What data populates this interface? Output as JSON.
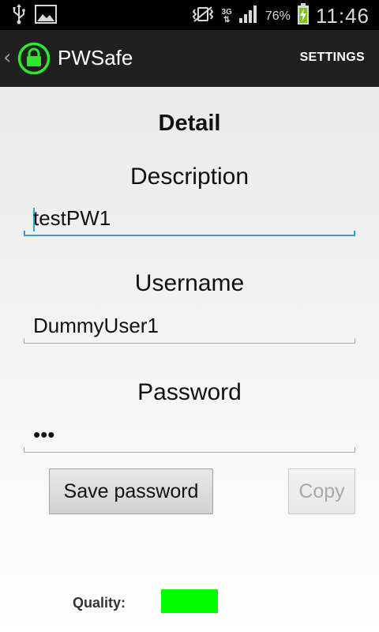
{
  "status_bar": {
    "network_type": "3G",
    "battery_percent": "76%",
    "time": "11:46",
    "icons": [
      "usb-icon",
      "gallery-icon",
      "vibrate-icon",
      "network-3g-icon",
      "signal-icon",
      "battery-charging-icon"
    ]
  },
  "action_bar": {
    "title": "PWSafe",
    "settings_label": "SETTINGS",
    "logo_color": "#2ee82e"
  },
  "detail": {
    "heading": "Detail",
    "description": {
      "label": "Description",
      "value": "testPW1",
      "focused": true
    },
    "username": {
      "label": "Username",
      "value": "DummyUser1"
    },
    "password": {
      "label": "Password",
      "value": "•••"
    },
    "save_button_label": "Save password",
    "copy_button_label": "Copy",
    "copy_enabled": false,
    "quality_label": "Quality:",
    "quality_color": "#00ff00",
    "accent_color": "#33a0d4"
  }
}
